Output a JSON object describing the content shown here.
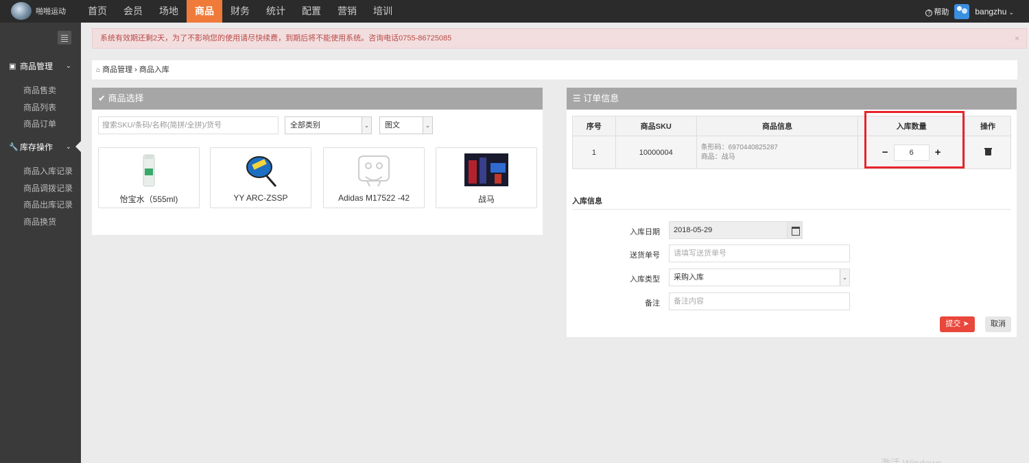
{
  "app": {
    "logo_text": "啪啪运动",
    "logo_icon": "app-logo-icon"
  },
  "nav": {
    "items": [
      "首页",
      "会员",
      "场地",
      "商品",
      "财务",
      "统计",
      "配置",
      "营销",
      "培训"
    ],
    "active": "商品"
  },
  "header_right": {
    "help_label": "帮助",
    "help_icon": "help-icon",
    "avatar_icon": "avatar-icon",
    "user_name": "bangzhu",
    "dropdown_icon": "chevron-down-icon"
  },
  "sidebar": {
    "groups": [
      {
        "label": "商品管理",
        "icon": "gift-icon",
        "items": [
          "商品售卖",
          "商品列表",
          "商品订单"
        ]
      },
      {
        "label": "库存操作",
        "icon": "wrench-icon",
        "items": [
          "商品入库记录",
          "商品调拨记录",
          "商品出库记录",
          "商品换货"
        ]
      }
    ]
  },
  "alert": {
    "text": "系统有效期还剩2天，为了不影响您的使用请尽快续费，到期后将不能使用系统。咨询电话0755-86725085",
    "close": "×"
  },
  "breadcrumb": {
    "items": [
      "商品管理",
      "商品入库"
    ],
    "separator": "›"
  },
  "product_panel": {
    "title": "商品选择",
    "search_placeholder": "搜索SKU/条码/名称(简拼/全拼)/货号",
    "category_select": "全部类别",
    "view_select": "图文",
    "products": [
      {
        "name": "怡宝水（555ml)"
      },
      {
        "name": "YY ARC-ZSSP"
      },
      {
        "name": "Adidas M17522 -42"
      },
      {
        "name": "战马"
      }
    ]
  },
  "order_panel": {
    "title": "订单信息",
    "columns": [
      "序号",
      "商品SKU",
      "商品信息",
      "入库数量",
      "操作"
    ],
    "rows": [
      {
        "index": "1",
        "sku": "10000004",
        "barcode_label": "条形码：6970440825287",
        "product_label": "商品：战马",
        "quantity": "6"
      }
    ],
    "qty_minus": "−",
    "qty_plus": "+"
  },
  "inbound_form": {
    "title": "入库信息",
    "date_label": "入库日期",
    "date_value": "2018-05-29",
    "delivery_label": "送货单号",
    "delivery_placeholder": "请填写送货单号",
    "type_label": "入库类型",
    "type_value": "采购入库",
    "note_label": "备注",
    "note_placeholder": "备注内容",
    "submit_label": "提交",
    "cancel_label": "取消"
  },
  "watermark": "激活 Windows",
  "colors": {
    "accent": "#f07a3a",
    "highlight_box": "#e8232a",
    "submit": "#e9473b",
    "topbar": "#2b2b2b",
    "sidebar": "#3a3a3a"
  }
}
